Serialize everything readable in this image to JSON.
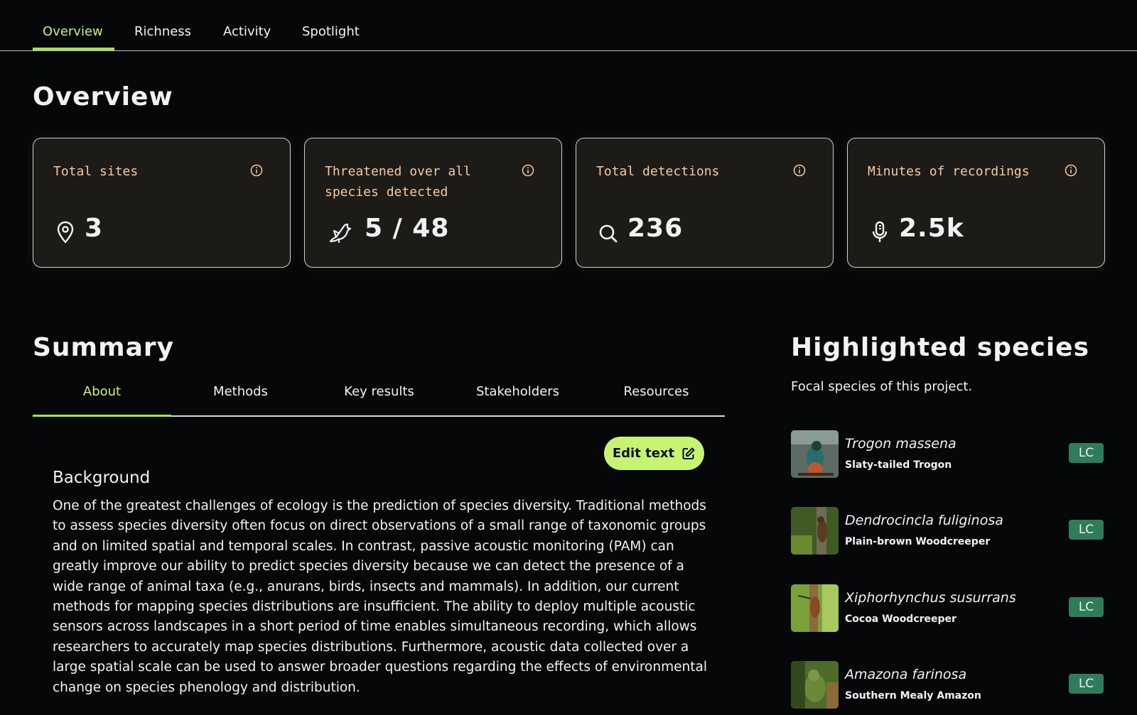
{
  "nav": {
    "tabs": [
      {
        "label": "Overview",
        "active": true
      },
      {
        "label": "Richness"
      },
      {
        "label": "Activity"
      },
      {
        "label": "Spotlight"
      }
    ]
  },
  "page_title": "Overview",
  "stats": [
    {
      "label": "Total sites",
      "icon": "map-pin-icon",
      "value": "3"
    },
    {
      "label": "Threatened over all species detected",
      "icon": "bird-icon",
      "value": "5 / 48"
    },
    {
      "label": "Total detections",
      "icon": "search-icon",
      "value": "236"
    },
    {
      "label": "Minutes of recordings",
      "icon": "microphone-icon",
      "value": "2.5k"
    }
  ],
  "summary": {
    "title": "Summary",
    "tabs": [
      {
        "label": "About",
        "active": true
      },
      {
        "label": "Methods"
      },
      {
        "label": "Key results"
      },
      {
        "label": "Stakeholders"
      },
      {
        "label": "Resources"
      }
    ],
    "edit_label": "Edit text",
    "background_heading": "Background",
    "background_text": "One of the greatest challenges of ecology is the prediction of species diversity. Traditional methods to assess species diversity often focus on direct observations of a small range of taxonomic groups and on limited spatial and temporal scales. In contrast, passive acoustic monitoring (PAM) can greatly improve our ability to predict species diversity because we can detect the presence of a wide range of animal taxa (e.g., anurans, birds, insects and mammals). In addition, our current methods for mapping species distributions are insufficient. The ability to deploy multiple acoustic sensors across landscapes in a short period of time enables simultaneous recording, which allows researchers to accurately map species distributions. Furthermore, acoustic data collected over a large spatial scale can be used to answer broader questions regarding the effects of environmental change on species phenology and distribution."
  },
  "highlighted": {
    "title": "Highlighted species",
    "subtitle": "Focal species of this project.",
    "species": [
      {
        "scientific": "Trogon massena",
        "common": "Slaty-tailed Trogon",
        "status": "LC"
      },
      {
        "scientific": "Dendrocincla fuliginosa",
        "common": "Plain-brown Woodcreeper",
        "status": "LC"
      },
      {
        "scientific": "Xiphorhynchus susurrans",
        "common": "Cocoa Woodcreeper",
        "status": "LC"
      },
      {
        "scientific": "Amazona farinosa",
        "common": "Southern Mealy Amazon",
        "status": "LC"
      }
    ]
  },
  "colors": {
    "background": "#060709",
    "accent": "#a4e54c",
    "card": "#1c1b17",
    "card_label": "#f6c9a2",
    "badge_lc": "#2f7c5a"
  }
}
